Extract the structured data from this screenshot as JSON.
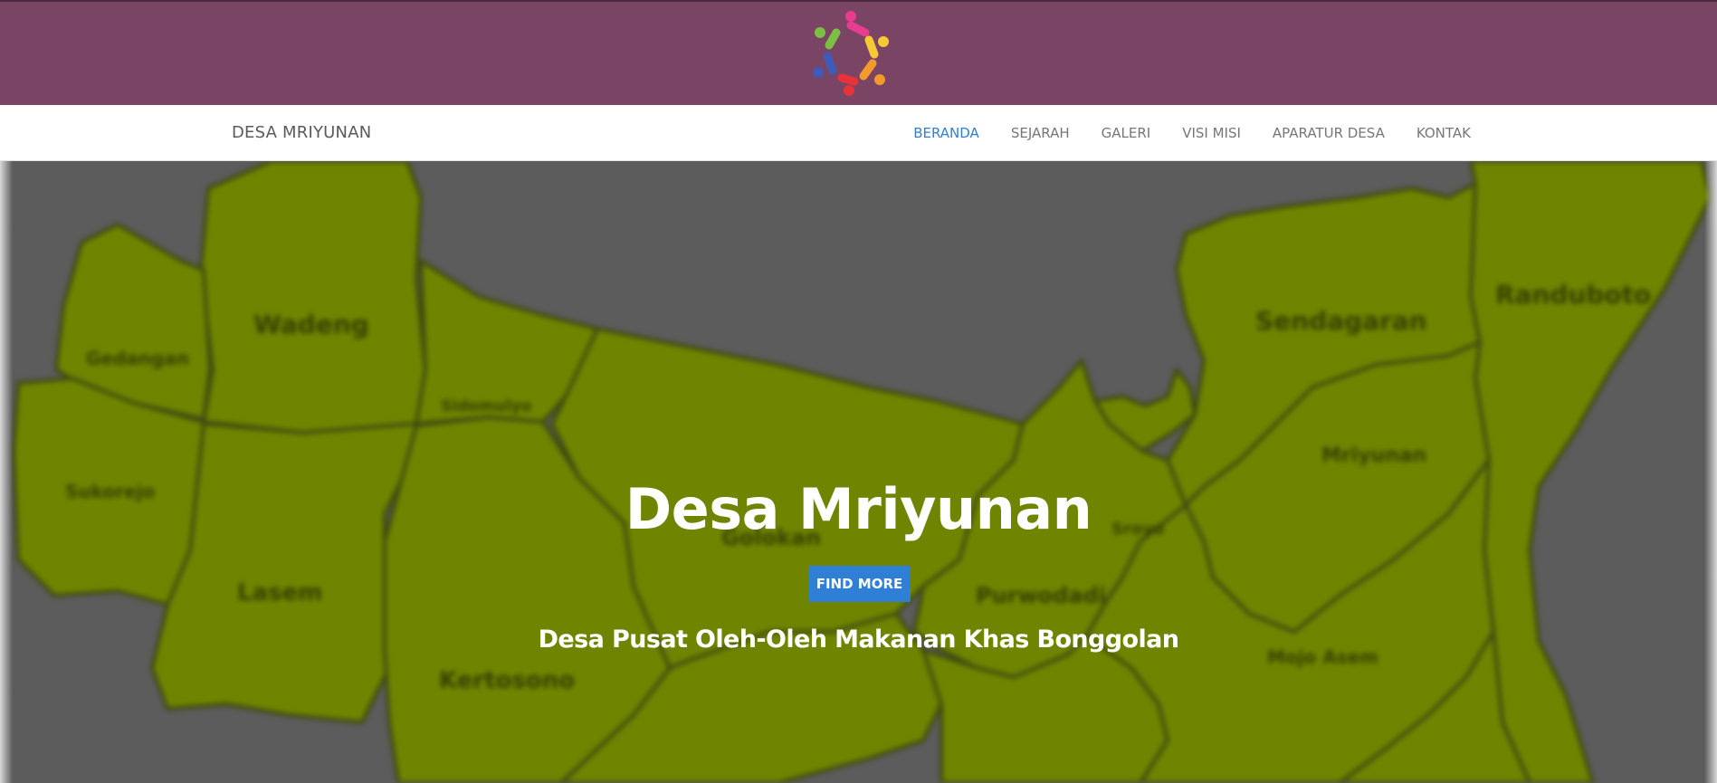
{
  "header": {
    "logo_icon": "colorful-people-circle-logo"
  },
  "navbar": {
    "brand": "DESA MRIYUNAN",
    "links": [
      {
        "label": "BERANDA",
        "active": true
      },
      {
        "label": "SEJARAH",
        "active": false
      },
      {
        "label": "GALERI",
        "active": false
      },
      {
        "label": "VISI MISI",
        "active": false
      },
      {
        "label": "APARATUR DESA",
        "active": false
      },
      {
        "label": "KONTAK",
        "active": false
      }
    ]
  },
  "hero": {
    "title": "Desa Mriyunan",
    "button_label": "FIND MORE",
    "subtitle": "Desa Pusat Oleh-Oleh Makanan Khas Bonggolan",
    "map_labels": [
      "Wadeng",
      "Gedangan",
      "Sidomulyo",
      "Sukorejo",
      "Lasem",
      "Kertosono",
      "Golokan",
      "Purwodadi",
      "Sroyo",
      "Sendagaran",
      "Randuboto",
      "Mriyunan",
      "Mojo Asem"
    ]
  },
  "colors": {
    "top_band": "#7a4565",
    "active_link": "#2f7fd6",
    "button": "#2f7fd6",
    "map_land": "#6f8500",
    "map_background": "#5c5c5c"
  }
}
